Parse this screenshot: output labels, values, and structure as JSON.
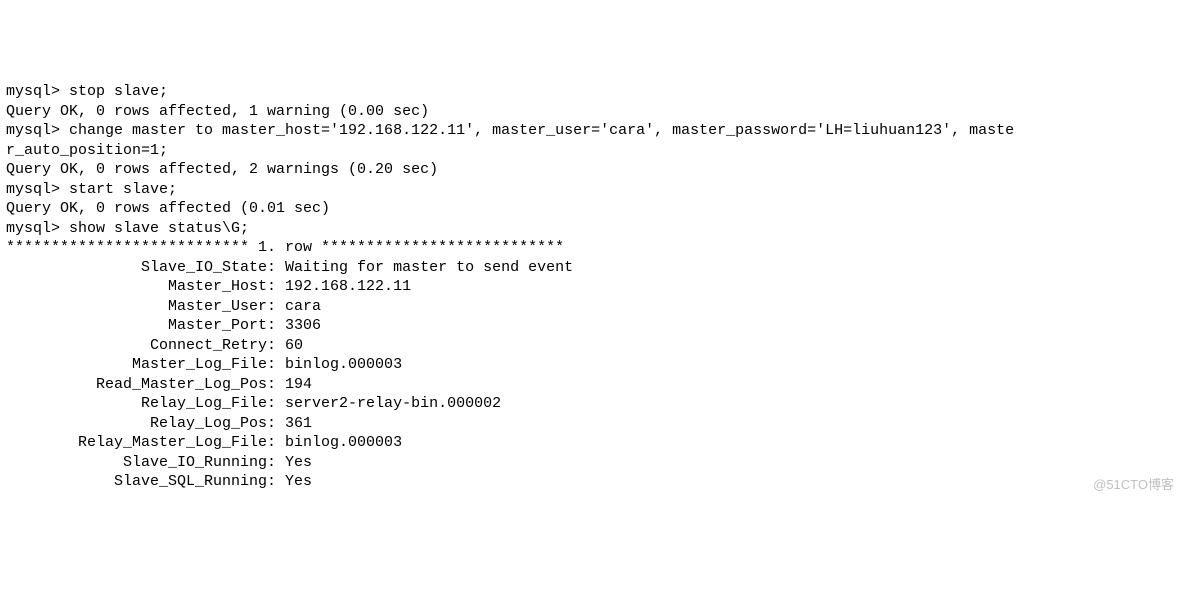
{
  "lines": [
    "mysql> stop slave;",
    "Query OK, 0 rows affected, 1 warning (0.00 sec)",
    "",
    "mysql> change master to master_host='192.168.122.11', master_user='cara', master_password='LH=liuhuan123', maste",
    "r_auto_position=1;",
    "Query OK, 0 rows affected, 2 warnings (0.20 sec)",
    "",
    "mysql> start slave;",
    "Query OK, 0 rows affected (0.01 sec)",
    "",
    "mysql> show slave status\\G;",
    "*************************** 1. row ***************************",
    "               Slave_IO_State: Waiting for master to send event",
    "                  Master_Host: 192.168.122.11",
    "                  Master_User: cara",
    "                  Master_Port: 3306",
    "                Connect_Retry: 60",
    "              Master_Log_File: binlog.000003",
    "          Read_Master_Log_Pos: 194",
    "               Relay_Log_File: server2-relay-bin.000002",
    "                Relay_Log_Pos: 361",
    "        Relay_Master_Log_File: binlog.000003",
    "             Slave_IO_Running: Yes",
    "            Slave_SQL_Running: Yes"
  ],
  "watermark": "@51CTO博客"
}
